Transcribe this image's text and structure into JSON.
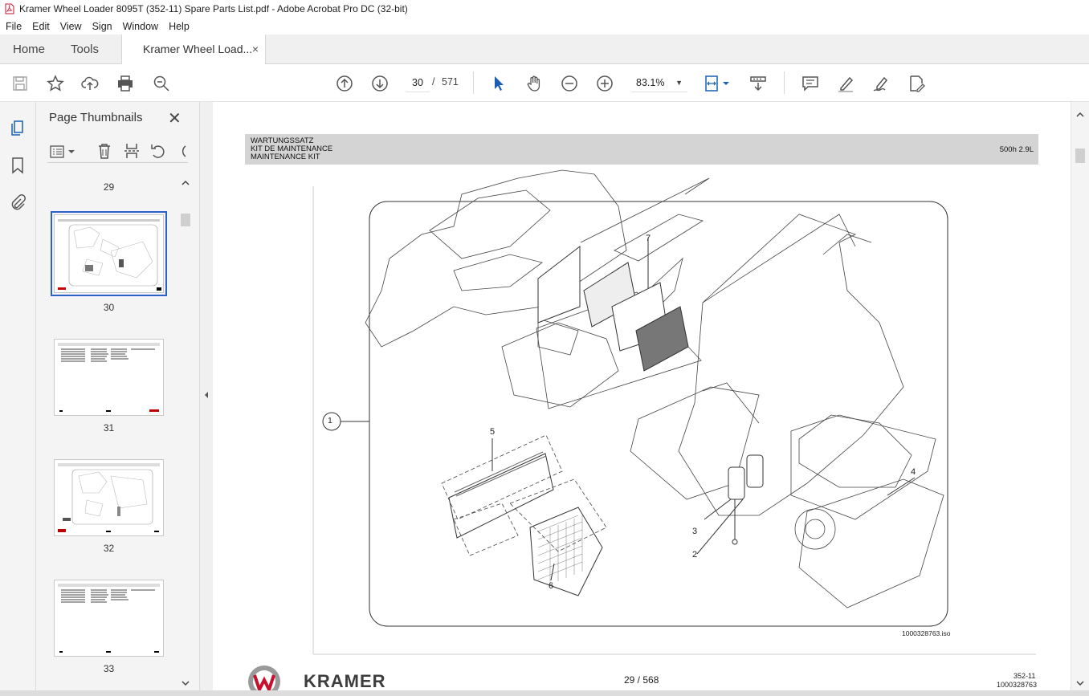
{
  "window": {
    "title": "Kramer Wheel Loader 8095T (352-11) Spare Parts List.pdf - Adobe Acrobat Pro DC (32-bit)"
  },
  "menu": [
    "File",
    "Edit",
    "View",
    "Sign",
    "Window",
    "Help"
  ],
  "tabs": {
    "home": "Home",
    "tools": "Tools",
    "document": "Kramer Wheel Load...",
    "close": "×"
  },
  "toolbar": {
    "current_page": "30",
    "page_separator": "/",
    "total_pages": "571",
    "zoom": "83.1%",
    "zoom_caret": "▼"
  },
  "thumbnails_panel": {
    "title": "Page Thumbnails",
    "close": "✕",
    "pages": [
      {
        "label": "29"
      },
      {
        "label": "30",
        "selected": true
      },
      {
        "label": "31"
      },
      {
        "label": "32"
      },
      {
        "label": "33"
      }
    ]
  },
  "page": {
    "header_lines": [
      "WARTUNGSSATZ",
      "KIT DE MAINTENANCE",
      "MAINTENANCE KIT"
    ],
    "header_right": "500h 2.9L",
    "callouts": [
      "1",
      "2",
      "3",
      "4",
      "5",
      "6",
      "7"
    ],
    "drawing_id": "1000328763.iso",
    "footer_page": "29 / 568",
    "footer_ref1": "352-11",
    "footer_ref2": "1000328763",
    "brand": "KRAMER"
  }
}
